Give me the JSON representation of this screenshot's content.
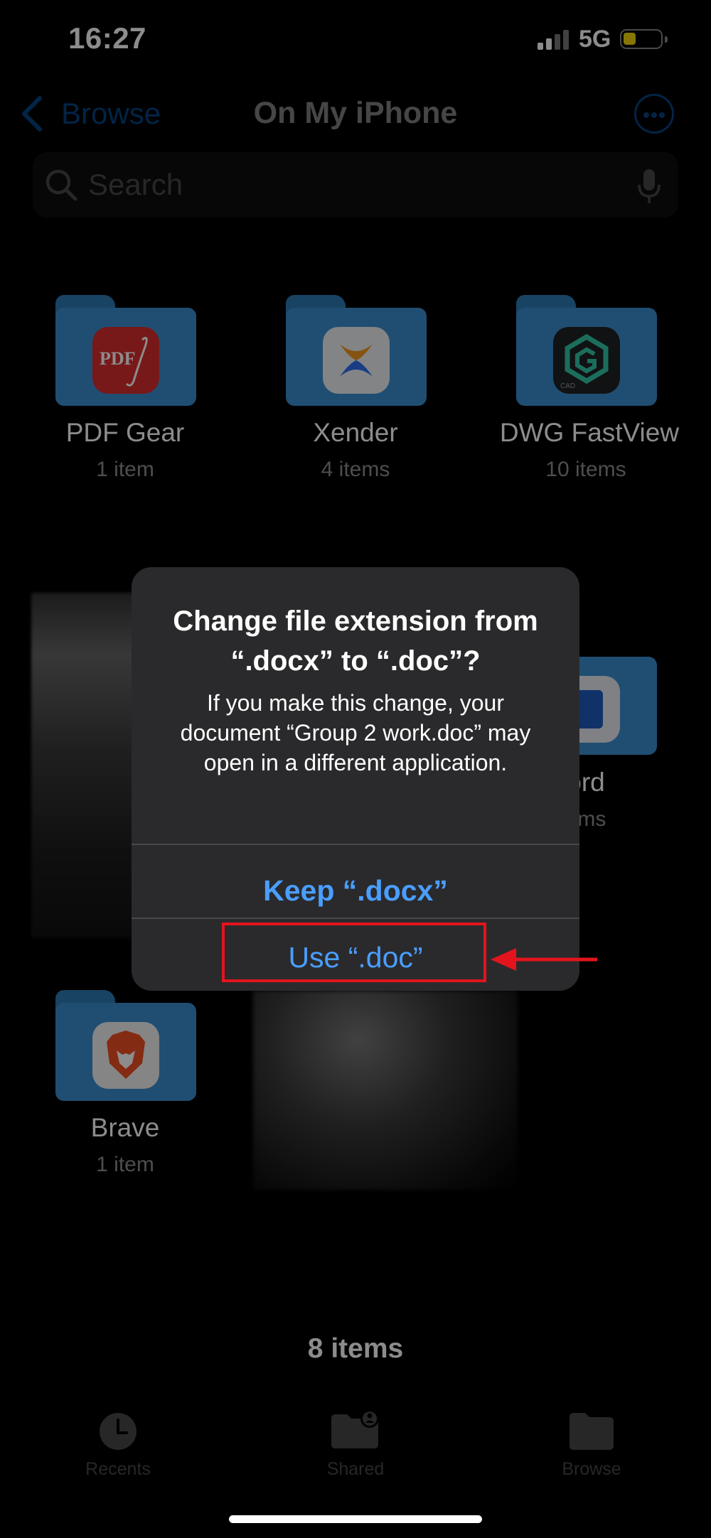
{
  "status_bar": {
    "time": "16:27",
    "network": "5G"
  },
  "nav": {
    "back_label": "Browse",
    "title": "On My iPhone"
  },
  "search": {
    "placeholder": "Search"
  },
  "folders": [
    {
      "name": "PDF Gear",
      "count": "1 item"
    },
    {
      "name": "Xender",
      "count": "4 items"
    },
    {
      "name": "DWG FastView",
      "count": "10 items"
    },
    {
      "name": "ord",
      "count": "ems"
    },
    {
      "name": "Brave",
      "count": "1 item"
    }
  ],
  "footer": {
    "items_count": "8 items"
  },
  "tabbar": {
    "recents": "Recents",
    "shared": "Shared",
    "browse": "Browse"
  },
  "alert": {
    "title": "Change file extension from “.docx” to “.doc”?",
    "message": "If you make this change, your document “Group 2 work.doc” may open in a different application.",
    "keep_button": "Keep “.docx”",
    "use_button": "Use “.doc”"
  },
  "icon_badges": {
    "pdf_gear": "PDF",
    "dwg": "CAD"
  },
  "colors": {
    "accent": "#0a84ff",
    "alert_button": "#4a9eff",
    "folder": "#3b8fd0",
    "highlight": "#e3141d",
    "battery": "#f5d90a"
  }
}
